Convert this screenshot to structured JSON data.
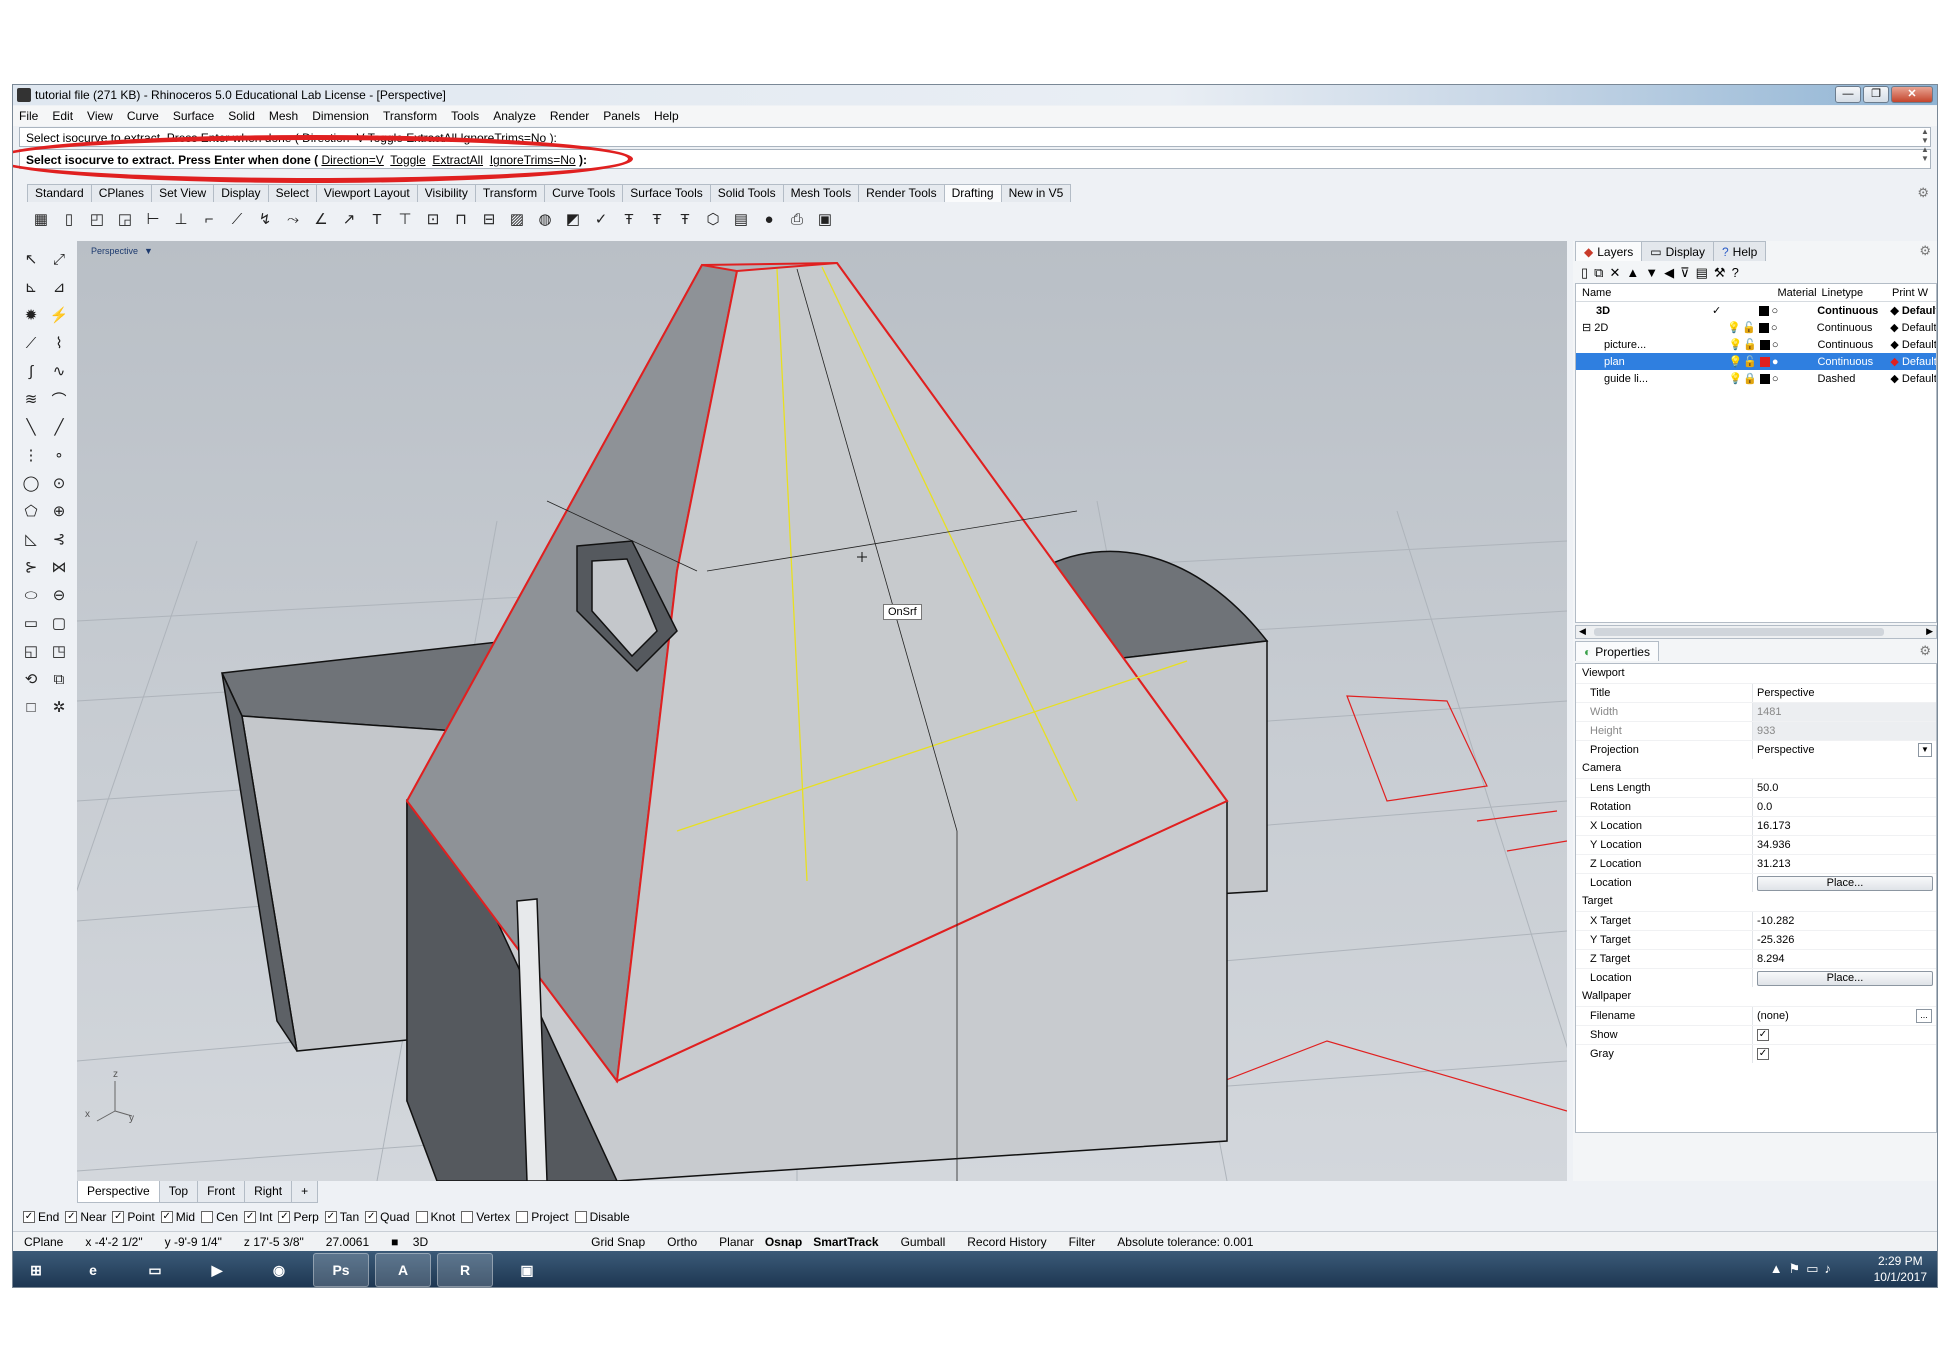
{
  "window": {
    "title": "tutorial file (271 KB) - Rhinoceros 5.0 Educational Lab License - [Perspective]",
    "controls": [
      "—",
      "❐",
      "✕"
    ]
  },
  "menu": [
    "File",
    "Edit",
    "View",
    "Curve",
    "Surface",
    "Solid",
    "Mesh",
    "Dimension",
    "Transform",
    "Tools",
    "Analyze",
    "Render",
    "Panels",
    "Help"
  ],
  "command": {
    "history": "Select isocurve to extract. Press Enter when done ( Direction=V  Toggle  ExtractAll  IgnoreTrims=No ):",
    "prompt": "Select isocurve to extract. Press Enter when done (",
    "opt_direction": "Direction=V",
    "opt_toggle": "Toggle",
    "opt_extractall": "ExtractAll",
    "opt_ignoretrims": "IgnoreTrims=No",
    "close": "):"
  },
  "toolbar_tabs": [
    "Standard",
    "CPlanes",
    "Set View",
    "Display",
    "Select",
    "Viewport Layout",
    "Visibility",
    "Transform",
    "Curve Tools",
    "Surface Tools",
    "Solid Tools",
    "Mesh Tools",
    "Render Tools",
    "Drafting",
    "New in V5"
  ],
  "active_toolbar_tab": "Drafting",
  "viewport": {
    "label": "Perspective",
    "osnap_tooltip": "OnSrf",
    "axis_z": "z",
    "axis_x": "x",
    "axis_y": "y"
  },
  "viewport_tabs": [
    "Perspective",
    "Top",
    "Front",
    "Right",
    "+"
  ],
  "osnaps": [
    {
      "label": "End",
      "checked": true
    },
    {
      "label": "Near",
      "checked": true
    },
    {
      "label": "Point",
      "checked": true
    },
    {
      "label": "Mid",
      "checked": true
    },
    {
      "label": "Cen",
      "checked": false
    },
    {
      "label": "Int",
      "checked": true
    },
    {
      "label": "Perp",
      "checked": true
    },
    {
      "label": "Tan",
      "checked": true
    },
    {
      "label": "Quad",
      "checked": true
    },
    {
      "label": "Knot",
      "checked": false
    },
    {
      "label": "Vertex",
      "checked": false
    },
    {
      "label": "Project",
      "checked": false
    },
    {
      "label": "Disable",
      "checked": false
    }
  ],
  "status": {
    "cplane": "CPlane",
    "x": "x -4'-2 1/2\"",
    "y": "y -9'-9 1/4\"",
    "z": "z 17'-5 3/8\"",
    "dist": "27.0061",
    "layer": "3D",
    "grid_snap": "Grid Snap",
    "ortho": "Ortho",
    "planar": "Planar",
    "osnap": "Osnap",
    "smarttrack": "SmartTrack",
    "gumball": "Gumball",
    "record_history": "Record History",
    "filter": "Filter",
    "tolerance": "Absolute tolerance: 0.001"
  },
  "panel_tabs": [
    "Layers",
    "Display",
    "Help"
  ],
  "layers": {
    "headers": {
      "name": "Name",
      "material": "Material",
      "linetype": "Linetype",
      "print_width": "Print W"
    },
    "rows": [
      {
        "name": "3D",
        "current": "✓",
        "color": "#000000",
        "linetype": "Continuous",
        "print": "Default",
        "bold": true,
        "selected": false
      },
      {
        "name": "2D",
        "current": "",
        "color": "#000000",
        "linetype": "Continuous",
        "print": "Default",
        "bold": false,
        "selected": false
      },
      {
        "name": "picture...",
        "current": "",
        "color": "#000000",
        "linetype": "Continuous",
        "print": "Default",
        "bold": false,
        "selected": false
      },
      {
        "name": "plan",
        "current": "",
        "color": "#e02020",
        "linetype": "Continuous",
        "print": "Default",
        "bold": false,
        "selected": true
      },
      {
        "name": "guide li...",
        "current": "",
        "color": "#000000",
        "linetype": "Dashed",
        "print": "Default",
        "bold": false,
        "selected": false
      }
    ]
  },
  "properties": {
    "tab": "Properties",
    "viewport_section": "Viewport",
    "title_k": "Title",
    "title_v": "Perspective",
    "width_k": "Width",
    "width_v": "1481",
    "height_k": "Height",
    "height_v": "933",
    "projection_k": "Projection",
    "projection_v": "Perspective",
    "camera_section": "Camera",
    "lens_k": "Lens Length",
    "lens_v": "50.0",
    "rotation_k": "Rotation",
    "rotation_v": "0.0",
    "xloc_k": "X Location",
    "xloc_v": "16.173",
    "yloc_k": "Y Location",
    "yloc_v": "34.936",
    "zloc_k": "Z Location",
    "zloc_v": "31.213",
    "loc_k": "Location",
    "place_btn": "Place...",
    "target_section": "Target",
    "xt_k": "X Target",
    "xt_v": "-10.282",
    "yt_k": "Y Target",
    "yt_v": "-25.326",
    "zt_k": "Z Target",
    "zt_v": "8.294",
    "tloc_k": "Location",
    "tplace_btn": "Place...",
    "wallpaper_section": "Wallpaper",
    "file_k": "Filename",
    "file_v": "(none)",
    "show_k": "Show",
    "gray_k": "Gray"
  },
  "taskbar": {
    "time": "2:29 PM",
    "date": "10/1/2017",
    "apps": [
      "windows-start",
      "internet-explorer",
      "file-explorer",
      "media-player",
      "chrome",
      "photoshop",
      "acrobat",
      "rhinoceros",
      "remote-desktop"
    ]
  }
}
